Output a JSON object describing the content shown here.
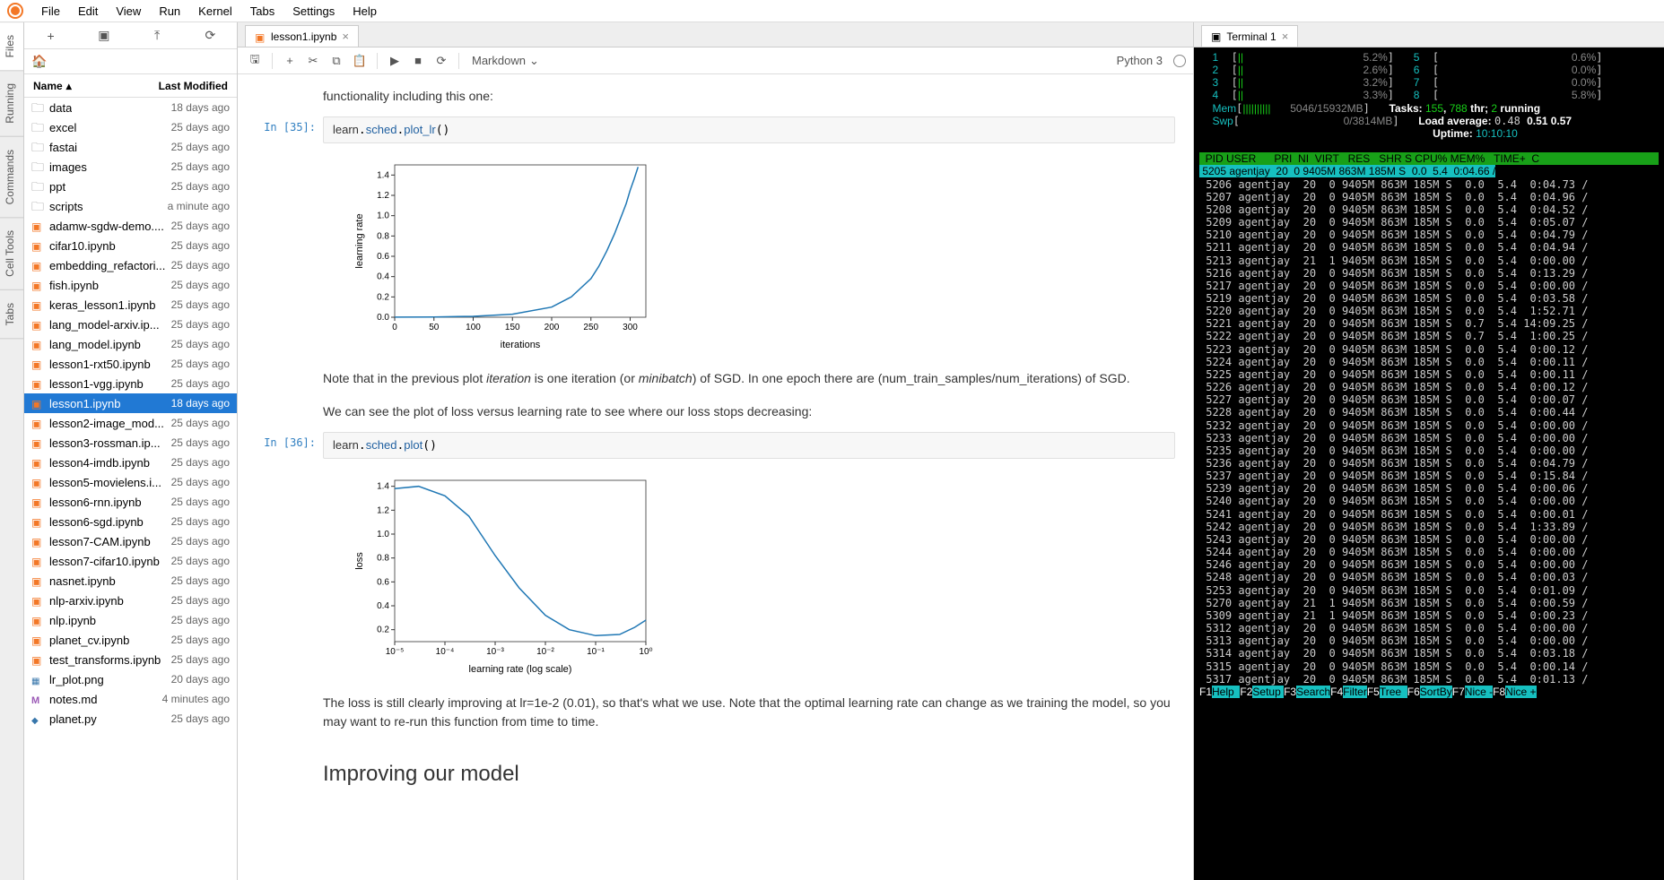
{
  "menu": [
    "File",
    "Edit",
    "View",
    "Run",
    "Kernel",
    "Tabs",
    "Settings",
    "Help"
  ],
  "leftbar": [
    "Files",
    "Running",
    "Commands",
    "Cell Tools",
    "Tabs"
  ],
  "filepanel": {
    "header_name": "Name",
    "header_mod": "Last Modified",
    "files": [
      {
        "n": "data",
        "m": "18 days ago",
        "t": "folder"
      },
      {
        "n": "excel",
        "m": "25 days ago",
        "t": "folder"
      },
      {
        "n": "fastai",
        "m": "25 days ago",
        "t": "folder"
      },
      {
        "n": "images",
        "m": "25 days ago",
        "t": "folder"
      },
      {
        "n": "ppt",
        "m": "25 days ago",
        "t": "folder"
      },
      {
        "n": "scripts",
        "m": "a minute ago",
        "t": "folder"
      },
      {
        "n": "adamw-sgdw-demo....",
        "m": "25 days ago",
        "t": "nb"
      },
      {
        "n": "cifar10.ipynb",
        "m": "25 days ago",
        "t": "nb"
      },
      {
        "n": "embedding_refactori...",
        "m": "25 days ago",
        "t": "nb"
      },
      {
        "n": "fish.ipynb",
        "m": "25 days ago",
        "t": "nb"
      },
      {
        "n": "keras_lesson1.ipynb",
        "m": "25 days ago",
        "t": "nb"
      },
      {
        "n": "lang_model-arxiv.ip...",
        "m": "25 days ago",
        "t": "nb"
      },
      {
        "n": "lang_model.ipynb",
        "m": "25 days ago",
        "t": "nb"
      },
      {
        "n": "lesson1-rxt50.ipynb",
        "m": "25 days ago",
        "t": "nb"
      },
      {
        "n": "lesson1-vgg.ipynb",
        "m": "25 days ago",
        "t": "nb"
      },
      {
        "n": "lesson1.ipynb",
        "m": "18 days ago",
        "t": "nb",
        "sel": true
      },
      {
        "n": "lesson2-image_mod...",
        "m": "25 days ago",
        "t": "nb"
      },
      {
        "n": "lesson3-rossman.ip...",
        "m": "25 days ago",
        "t": "nb"
      },
      {
        "n": "lesson4-imdb.ipynb",
        "m": "25 days ago",
        "t": "nb"
      },
      {
        "n": "lesson5-movielens.i...",
        "m": "25 days ago",
        "t": "nb"
      },
      {
        "n": "lesson6-rnn.ipynb",
        "m": "25 days ago",
        "t": "nb"
      },
      {
        "n": "lesson6-sgd.ipynb",
        "m": "25 days ago",
        "t": "nb"
      },
      {
        "n": "lesson7-CAM.ipynb",
        "m": "25 days ago",
        "t": "nb"
      },
      {
        "n": "lesson7-cifar10.ipynb",
        "m": "25 days ago",
        "t": "nb"
      },
      {
        "n": "nasnet.ipynb",
        "m": "25 days ago",
        "t": "nb"
      },
      {
        "n": "nlp-arxiv.ipynb",
        "m": "25 days ago",
        "t": "nb"
      },
      {
        "n": "nlp.ipynb",
        "m": "25 days ago",
        "t": "nb"
      },
      {
        "n": "planet_cv.ipynb",
        "m": "25 days ago",
        "t": "nb"
      },
      {
        "n": "test_transforms.ipynb",
        "m": "25 days ago",
        "t": "nb"
      },
      {
        "n": "lr_plot.png",
        "m": "20 days ago",
        "t": "img"
      },
      {
        "n": "notes.md",
        "m": "4 minutes ago",
        "t": "md"
      },
      {
        "n": "planet.py",
        "m": "25 days ago",
        "t": "py"
      }
    ]
  },
  "tabs": {
    "nb": "lesson1.ipynb",
    "term": "Terminal 1"
  },
  "nb": {
    "celltype": "Markdown",
    "kernel": "Python 3",
    "md0": "functionality including this one:",
    "p1": "In [35]:",
    "code1": "learn.sched.plot_lr()",
    "md1a": "Note that in the previous plot ",
    "md1b": "iteration",
    "md1c": " is one iteration (or ",
    "md1d": "minibatch",
    "md1e": ") of SGD. In one epoch there are (num_train_samples/num_iterations) of SGD.",
    "md2": "We can see the plot of loss versus learning rate to see where our loss stops decreasing:",
    "p2": "In [36]:",
    "code2": "learn.sched.plot()",
    "md3": "The loss is still clearly improving at lr=1e-2 (0.01), so that's what we use. Note that the optimal learning rate can change as we training the model, so you may want to re-run this function from time to time.",
    "h2": "Improving our model"
  },
  "chart_data": [
    {
      "type": "line",
      "title": "",
      "xlabel": "iterations",
      "ylabel": "learning rate",
      "xlim": [
        0,
        320
      ],
      "ylim": [
        0,
        1.5
      ],
      "xticks": [
        0,
        50,
        100,
        150,
        200,
        250,
        300
      ],
      "yticks": [
        0.0,
        0.2,
        0.4,
        0.6,
        0.8,
        1.0,
        1.2,
        1.4
      ],
      "x": [
        0,
        50,
        100,
        150,
        200,
        225,
        250,
        260,
        270,
        280,
        290,
        295,
        300,
        305,
        310
      ],
      "y": [
        0.001,
        0.003,
        0.009,
        0.03,
        0.1,
        0.2,
        0.38,
        0.5,
        0.65,
        0.82,
        1.02,
        1.12,
        1.25,
        1.36,
        1.48
      ]
    },
    {
      "type": "line",
      "title": "",
      "xlabel": "learning rate (log scale)",
      "ylabel": "loss",
      "xscale": "log",
      "xlim": [
        1e-05,
        1.0
      ],
      "ylim": [
        0.1,
        1.45
      ],
      "xticks": [
        "10⁻⁵",
        "10⁻⁴",
        "10⁻³",
        "10⁻²",
        "10⁻¹",
        "10⁰"
      ],
      "yticks": [
        0.2,
        0.4,
        0.6,
        0.8,
        1.0,
        1.2,
        1.4
      ],
      "x": [
        1e-05,
        3e-05,
        0.0001,
        0.0003,
        0.001,
        0.003,
        0.01,
        0.03,
        0.1,
        0.3,
        0.6,
        1.0
      ],
      "y": [
        1.38,
        1.4,
        1.32,
        1.15,
        0.82,
        0.55,
        0.32,
        0.2,
        0.15,
        0.16,
        0.22,
        0.28
      ]
    }
  ],
  "term": {
    "cpus": [
      [
        "1",
        "5.2%"
      ],
      [
        "2",
        "2.6%"
      ],
      [
        "3",
        "3.2%"
      ],
      [
        "4",
        "3.3%"
      ],
      [
        "5",
        "0.6%"
      ],
      [
        "6",
        "0.0%"
      ],
      [
        "7",
        "0.0%"
      ],
      [
        "8",
        "5.8%"
      ]
    ],
    "mem": "5046/15932MB",
    "swp": "0/3814MB",
    "tasks": "Tasks: 155, 788 thr; 2 running",
    "lavg": "Load average: 0.48 0.51 0.57",
    "uptime": "Uptime: 10:10:10",
    "cols": "  PID USER      PRI  NI  VIRT   RES   SHR S CPU% MEM%   TIME+  C",
    "rows": [
      [
        " 5205",
        "agentjay",
        " 20",
        "  0",
        "9405M",
        " 863M",
        " 185M",
        "S",
        " 0.0",
        " 5.4",
        " 0:04.66",
        "/",
        true
      ],
      [
        " 5206",
        "agentjay",
        " 20",
        "  0",
        "9405M",
        " 863M",
        " 185M",
        "S",
        " 0.0",
        " 5.4",
        " 0:04.73",
        "/"
      ],
      [
        " 5207",
        "agentjay",
        " 20",
        "  0",
        "9405M",
        " 863M",
        " 185M",
        "S",
        " 0.0",
        " 5.4",
        " 0:04.96",
        "/"
      ],
      [
        " 5208",
        "agentjay",
        " 20",
        "  0",
        "9405M",
        " 863M",
        " 185M",
        "S",
        " 0.0",
        " 5.4",
        " 0:04.52",
        "/"
      ],
      [
        " 5209",
        "agentjay",
        " 20",
        "  0",
        "9405M",
        " 863M",
        " 185M",
        "S",
        " 0.0",
        " 5.4",
        " 0:05.07",
        "/"
      ],
      [
        " 5210",
        "agentjay",
        " 20",
        "  0",
        "9405M",
        " 863M",
        " 185M",
        "S",
        " 0.0",
        " 5.4",
        " 0:04.79",
        "/"
      ],
      [
        " 5211",
        "agentjay",
        " 20",
        "  0",
        "9405M",
        " 863M",
        " 185M",
        "S",
        " 0.0",
        " 5.4",
        " 0:04.94",
        "/"
      ],
      [
        " 5213",
        "agentjay",
        " 21",
        "  1",
        "9405M",
        " 863M",
        " 185M",
        "S",
        " 0.0",
        " 5.4",
        " 0:00.00",
        "/"
      ],
      [
        " 5216",
        "agentjay",
        " 20",
        "  0",
        "9405M",
        " 863M",
        " 185M",
        "S",
        " 0.0",
        " 5.4",
        " 0:13.29",
        "/"
      ],
      [
        " 5217",
        "agentjay",
        " 20",
        "  0",
        "9405M",
        " 863M",
        " 185M",
        "S",
        " 0.0",
        " 5.4",
        " 0:00.00",
        "/"
      ],
      [
        " 5219",
        "agentjay",
        " 20",
        "  0",
        "9405M",
        " 863M",
        " 185M",
        "S",
        " 0.0",
        " 5.4",
        " 0:03.58",
        "/"
      ],
      [
        " 5220",
        "agentjay",
        " 20",
        "  0",
        "9405M",
        " 863M",
        " 185M",
        "S",
        " 0.0",
        " 5.4",
        " 1:52.71",
        "/"
      ],
      [
        " 5221",
        "agentjay",
        " 20",
        "  0",
        "9405M",
        " 863M",
        " 185M",
        "S",
        " 0.7",
        " 5.4",
        "14:09.25",
        "/"
      ],
      [
        " 5222",
        "agentjay",
        " 20",
        "  0",
        "9405M",
        " 863M",
        " 185M",
        "S",
        " 0.7",
        " 5.4",
        " 1:00.25",
        "/"
      ],
      [
        " 5223",
        "agentjay",
        " 20",
        "  0",
        "9405M",
        " 863M",
        " 185M",
        "S",
        " 0.0",
        " 5.4",
        " 0:00.12",
        "/"
      ],
      [
        " 5224",
        "agentjay",
        " 20",
        "  0",
        "9405M",
        " 863M",
        " 185M",
        "S",
        " 0.0",
        " 5.4",
        " 0:00.11",
        "/"
      ],
      [
        " 5225",
        "agentjay",
        " 20",
        "  0",
        "9405M",
        " 863M",
        " 185M",
        "S",
        " 0.0",
        " 5.4",
        " 0:00.11",
        "/"
      ],
      [
        " 5226",
        "agentjay",
        " 20",
        "  0",
        "9405M",
        " 863M",
        " 185M",
        "S",
        " 0.0",
        " 5.4",
        " 0:00.12",
        "/"
      ],
      [
        " 5227",
        "agentjay",
        " 20",
        "  0",
        "9405M",
        " 863M",
        " 185M",
        "S",
        " 0.0",
        " 5.4",
        " 0:00.07",
        "/"
      ],
      [
        " 5228",
        "agentjay",
        " 20",
        "  0",
        "9405M",
        " 863M",
        " 185M",
        "S",
        " 0.0",
        " 5.4",
        " 0:00.44",
        "/"
      ],
      [
        " 5232",
        "agentjay",
        " 20",
        "  0",
        "9405M",
        " 863M",
        " 185M",
        "S",
        " 0.0",
        " 5.4",
        " 0:00.00",
        "/"
      ],
      [
        " 5233",
        "agentjay",
        " 20",
        "  0",
        "9405M",
        " 863M",
        " 185M",
        "S",
        " 0.0",
        " 5.4",
        " 0:00.00",
        "/"
      ],
      [
        " 5235",
        "agentjay",
        " 20",
        "  0",
        "9405M",
        " 863M",
        " 185M",
        "S",
        " 0.0",
        " 5.4",
        " 0:00.00",
        "/"
      ],
      [
        " 5236",
        "agentjay",
        " 20",
        "  0",
        "9405M",
        " 863M",
        " 185M",
        "S",
        " 0.0",
        " 5.4",
        " 0:04.79",
        "/"
      ],
      [
        " 5237",
        "agentjay",
        " 20",
        "  0",
        "9405M",
        " 863M",
        " 185M",
        "S",
        " 0.0",
        " 5.4",
        " 0:15.84",
        "/"
      ],
      [
        " 5239",
        "agentjay",
        " 20",
        "  0",
        "9405M",
        " 863M",
        " 185M",
        "S",
        " 0.0",
        " 5.4",
        " 0:00.06",
        "/"
      ],
      [
        " 5240",
        "agentjay",
        " 20",
        "  0",
        "9405M",
        " 863M",
        " 185M",
        "S",
        " 0.0",
        " 5.4",
        " 0:00.00",
        "/"
      ],
      [
        " 5241",
        "agentjay",
        " 20",
        "  0",
        "9405M",
        " 863M",
        " 185M",
        "S",
        " 0.0",
        " 5.4",
        " 0:00.01",
        "/"
      ],
      [
        " 5242",
        "agentjay",
        " 20",
        "  0",
        "9405M",
        " 863M",
        " 185M",
        "S",
        " 0.0",
        " 5.4",
        " 1:33.89",
        "/"
      ],
      [
        " 5243",
        "agentjay",
        " 20",
        "  0",
        "9405M",
        " 863M",
        " 185M",
        "S",
        " 0.0",
        " 5.4",
        " 0:00.00",
        "/"
      ],
      [
        " 5244",
        "agentjay",
        " 20",
        "  0",
        "9405M",
        " 863M",
        " 185M",
        "S",
        " 0.0",
        " 5.4",
        " 0:00.00",
        "/"
      ],
      [
        " 5246",
        "agentjay",
        " 20",
        "  0",
        "9405M",
        " 863M",
        " 185M",
        "S",
        " 0.0",
        " 5.4",
        " 0:00.00",
        "/"
      ],
      [
        " 5248",
        "agentjay",
        " 20",
        "  0",
        "9405M",
        " 863M",
        " 185M",
        "S",
        " 0.0",
        " 5.4",
        " 0:00.03",
        "/"
      ],
      [
        " 5253",
        "agentjay",
        " 20",
        "  0",
        "9405M",
        " 863M",
        " 185M",
        "S",
        " 0.0",
        " 5.4",
        " 0:01.09",
        "/"
      ],
      [
        " 5270",
        "agentjay",
        " 21",
        "  1",
        "9405M",
        " 863M",
        " 185M",
        "S",
        " 0.0",
        " 5.4",
        " 0:00.59",
        "/"
      ],
      [
        " 5309",
        "agentjay",
        " 21",
        "  1",
        "9405M",
        " 863M",
        " 185M",
        "S",
        " 0.0",
        " 5.4",
        " 0:00.23",
        "/"
      ],
      [
        " 5312",
        "agentjay",
        " 20",
        "  0",
        "9405M",
        " 863M",
        " 185M",
        "S",
        " 0.0",
        " 5.4",
        " 0:00.00",
        "/"
      ],
      [
        " 5313",
        "agentjay",
        " 20",
        "  0",
        "9405M",
        " 863M",
        " 185M",
        "S",
        " 0.0",
        " 5.4",
        " 0:00.00",
        "/"
      ],
      [
        " 5314",
        "agentjay",
        " 20",
        "  0",
        "9405M",
        " 863M",
        " 185M",
        "S",
        " 0.0",
        " 5.4",
        " 0:03.18",
        "/"
      ],
      [
        " 5315",
        "agentjay",
        " 20",
        "  0",
        "9405M",
        " 863M",
        " 185M",
        "S",
        " 0.0",
        " 5.4",
        " 0:00.14",
        "/"
      ],
      [
        " 5317",
        "agentjay",
        " 20",
        "  0",
        "9405M",
        " 863M",
        " 185M",
        "S",
        " 0.0",
        " 5.4",
        " 0:01.13",
        "/"
      ]
    ],
    "fkeys": [
      [
        "F1",
        "Help"
      ],
      [
        "F2",
        "Setup"
      ],
      [
        "F3",
        "Search"
      ],
      [
        "F4",
        "Filter"
      ],
      [
        "F5",
        "Tree"
      ],
      [
        "F6",
        "SortBy"
      ],
      [
        "F7",
        "Nice -"
      ],
      [
        "F8",
        "Nice +"
      ]
    ]
  }
}
